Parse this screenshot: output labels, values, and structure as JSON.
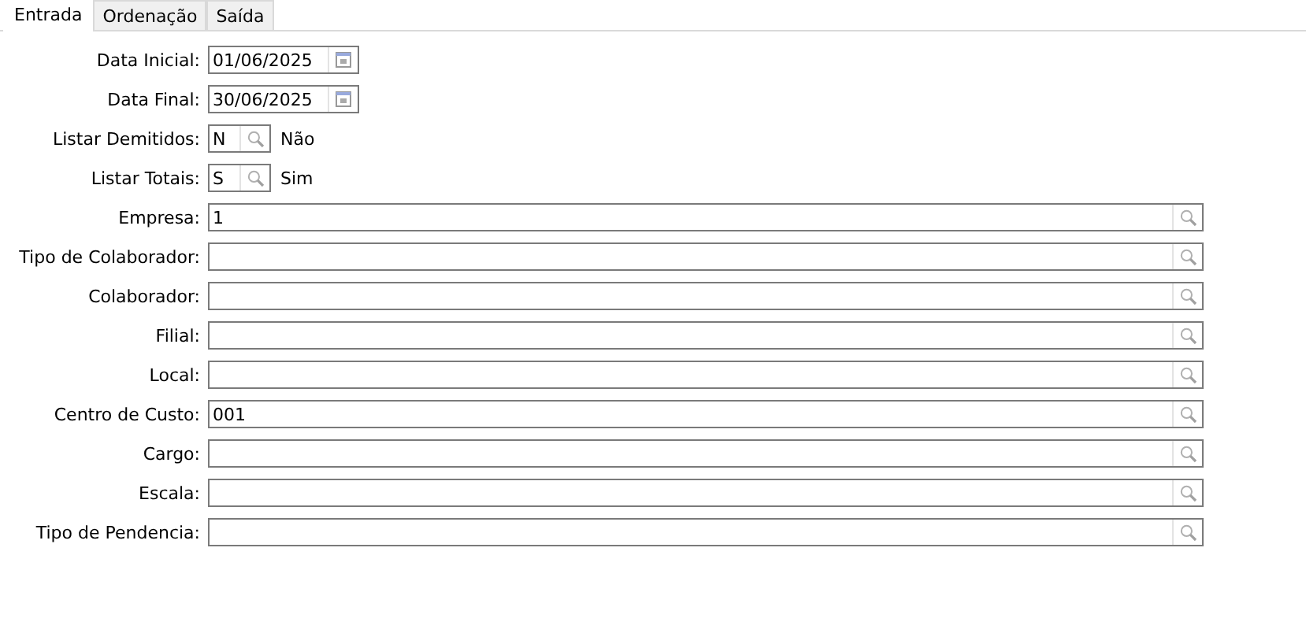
{
  "tabs": [
    {
      "label": "Entrada",
      "selected": true
    },
    {
      "label": "Ordenação",
      "selected": false
    },
    {
      "label": "Saída",
      "selected": false
    }
  ],
  "fields": [
    {
      "kind": "date",
      "label": "Data Inicial:",
      "value": "01/06/2025"
    },
    {
      "kind": "date",
      "label": "Data Final:",
      "value": "30/06/2025"
    },
    {
      "kind": "code",
      "label": "Listar Demitidos:",
      "value": "N",
      "description": "Não"
    },
    {
      "kind": "code",
      "label": "Listar Totais:",
      "value": "S",
      "description": "Sim"
    },
    {
      "kind": "lookup",
      "label": "Empresa:",
      "value": "1"
    },
    {
      "kind": "lookup",
      "label": "Tipo de Colaborador:"
    },
    {
      "kind": "lookup",
      "label": "Colaborador:"
    },
    {
      "kind": "lookup",
      "label": "Filial:"
    },
    {
      "kind": "lookup",
      "label": "Local:"
    },
    {
      "kind": "lookup",
      "label": "Centro de Custo:",
      "value": "001"
    },
    {
      "kind": "lookup",
      "label": "Cargo:"
    },
    {
      "kind": "lookup",
      "label": "Escala:"
    },
    {
      "kind": "lookup",
      "label": "Tipo de Pendencia:"
    }
  ]
}
